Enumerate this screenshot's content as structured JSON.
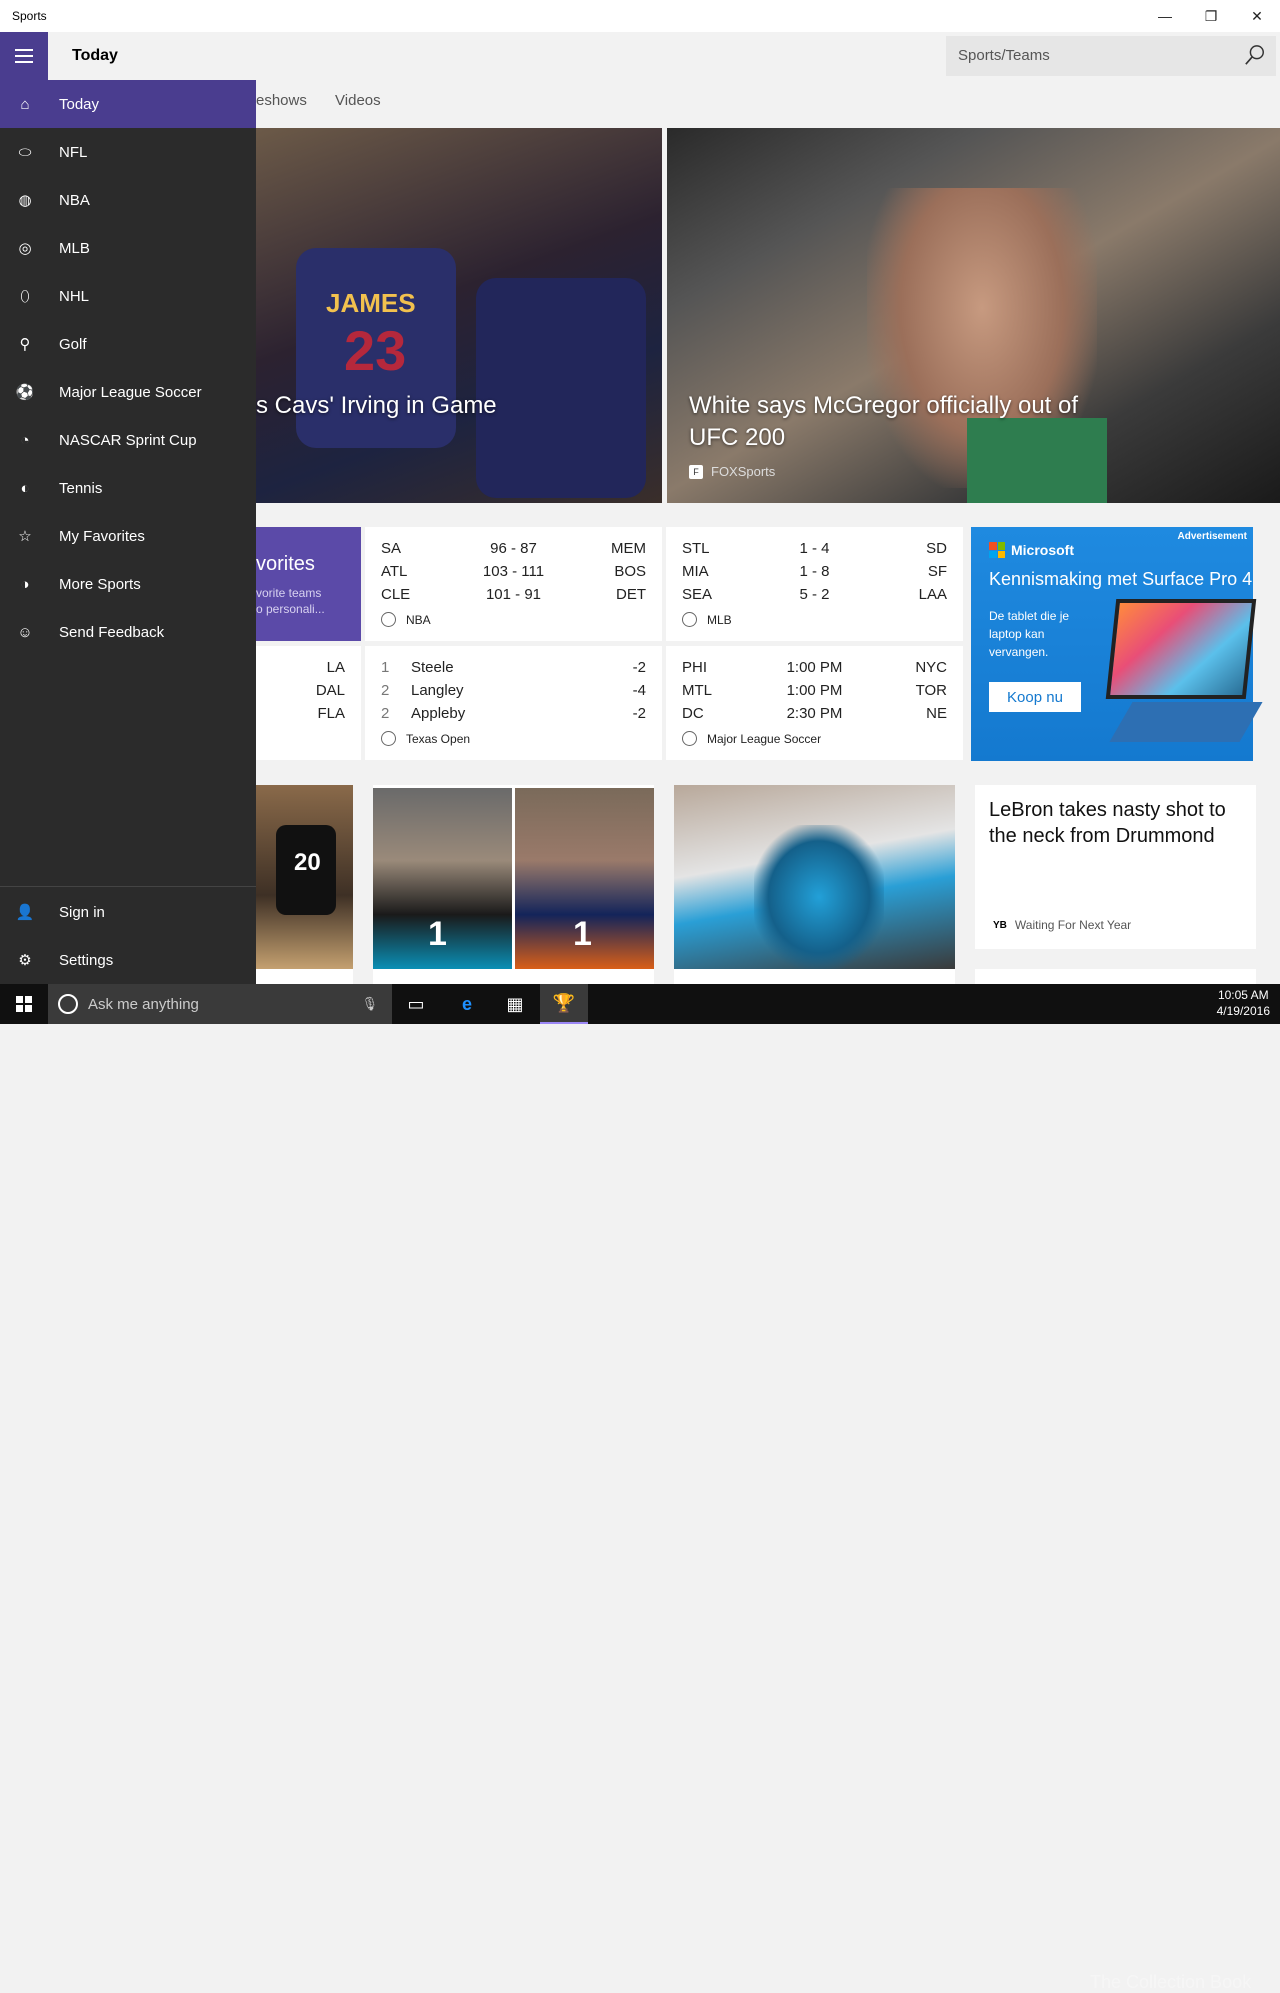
{
  "window": {
    "title": "Sports"
  },
  "appbar": {
    "page_title": "Today",
    "search_placeholder": "Sports/Teams"
  },
  "tabs": {
    "slideshows": "eshows",
    "videos": "Videos"
  },
  "hero": [
    {
      "headline": "s Cavs' Irving in Game",
      "jersey_name": "JAMES",
      "jersey_number": "23"
    },
    {
      "headline": "White says McGregor officially out of UFC 200",
      "source": "FOXSports"
    }
  ],
  "favorites_card": {
    "heading": "vorites",
    "text_line1": "vorite teams",
    "text_line2": "o personali..."
  },
  "lax_card": {
    "rows": [
      "LA",
      "DAL",
      "FLA"
    ]
  },
  "scores": {
    "nba": {
      "rows": [
        [
          "SA",
          "96  -  87",
          "MEM"
        ],
        [
          "ATL",
          "103  -  111",
          "BOS"
        ],
        [
          "CLE",
          "101  -  91",
          "DET"
        ]
      ],
      "label": "NBA"
    },
    "mlb": {
      "rows": [
        [
          "STL",
          "1  -  4",
          "SD"
        ],
        [
          "MIA",
          "1  -  8",
          "SF"
        ],
        [
          "SEA",
          "5  -  2",
          "LAA"
        ]
      ],
      "label": "MLB"
    },
    "golf": {
      "rows": [
        [
          "1",
          "Steele",
          "-2"
        ],
        [
          "2",
          "Langley",
          "-4"
        ],
        [
          "2",
          "Appleby",
          "-2"
        ]
      ],
      "label": "Texas Open"
    },
    "mls": {
      "rows": [
        [
          "PHI",
          "1:00 PM",
          "NYC"
        ],
        [
          "MTL",
          "1:00 PM",
          "TOR"
        ],
        [
          "DC",
          "2:30 PM",
          "NE"
        ]
      ],
      "label": "Major League Soccer"
    }
  },
  "ad": {
    "label": "Advertisement",
    "brand": "Microsoft",
    "headline": "Kennismaking met Surface Pro 4",
    "body": "De tablet die je laptop kan vervangen.",
    "button": "Koop nu"
  },
  "tiles": {
    "spurs_number": "20",
    "draft_number_1": "1",
    "draft_number_2": "1"
  },
  "news_card": {
    "headline": "LeBron takes nasty shot to the neck from Drummond",
    "source_badge": "YB",
    "source": "Waiting For Next Year"
  },
  "nav": {
    "items": [
      {
        "label": "Today",
        "icon": "home-icon",
        "glyph": "⌂"
      },
      {
        "label": "NFL",
        "icon": "football-icon",
        "glyph": "⬭"
      },
      {
        "label": "NBA",
        "icon": "basketball-icon",
        "glyph": "◍"
      },
      {
        "label": "MLB",
        "icon": "baseball-icon",
        "glyph": "◎"
      },
      {
        "label": "NHL",
        "icon": "hockey-icon",
        "glyph": "⬯"
      },
      {
        "label": "Golf",
        "icon": "golf-icon",
        "glyph": "⚲"
      },
      {
        "label": "Major League Soccer",
        "icon": "soccer-icon",
        "glyph": "⚽"
      },
      {
        "label": "NASCAR Sprint Cup",
        "icon": "nascar-icon",
        "glyph": "◔"
      },
      {
        "label": "Tennis",
        "icon": "tennis-icon",
        "glyph": "◐"
      },
      {
        "label": "My Favorites",
        "icon": "star-list-icon",
        "glyph": "☆"
      },
      {
        "label": "More Sports",
        "icon": "more-sports-icon",
        "glyph": "◑"
      },
      {
        "label": "Send Feedback",
        "icon": "smiley-icon",
        "glyph": "☺"
      }
    ],
    "sign_in": "Sign in",
    "settings": "Settings"
  },
  "taskbar": {
    "cortana_placeholder": "Ask me anything",
    "time": "10:05 AM",
    "date": "4/19/2016",
    "watermark": "The Collection Book"
  },
  "colors": {
    "accent": "#4a3d8f",
    "nav_bg": "#2b2b2b",
    "ad_blue": "#1479cf"
  }
}
